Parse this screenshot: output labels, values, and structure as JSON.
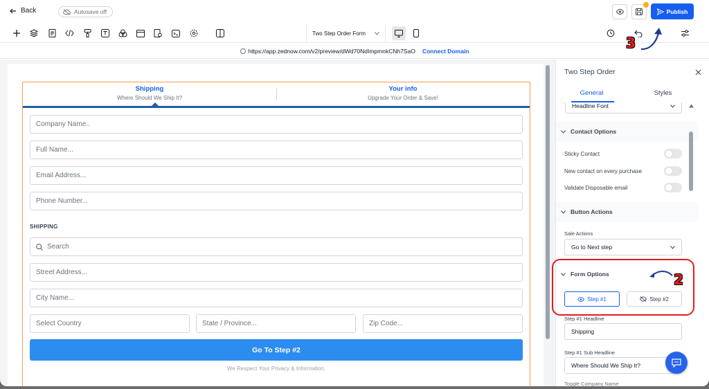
{
  "topbar": {
    "back_label": "Back",
    "autosave_label": "Autosave off",
    "publish_label": "Publish"
  },
  "toolbar": {
    "form_select_label": "Two Step Order Form"
  },
  "url": {
    "address": "https://app.zednow.com/v2/preview/dWd70NdImpmnkCNh7SaO",
    "connect_label": "Connect Domain"
  },
  "form": {
    "step1_title": "Shipping",
    "step1_sub": "Where Should We Ship It?",
    "step2_title": "Your info",
    "step2_sub": "Upgrade Your Order & Save!",
    "company_placeholder": "Company Name..",
    "fullname_placeholder": "Full Name...",
    "email_placeholder": "Email Address...",
    "phone_placeholder": "Phone Number...",
    "shipping_label": "SHIPPING",
    "search_placeholder": "Search",
    "street_placeholder": "Street Address...",
    "city_placeholder": "City Name...",
    "country_placeholder": "Select Country",
    "state_placeholder": "State / Province...",
    "zip_placeholder": "Zip Code...",
    "button_label": "Go To Step #2",
    "privacy_text": "We Respect Your Privacy & Information."
  },
  "panel": {
    "title": "Two Step Order",
    "tab_general": "General",
    "tab_styles": "Styles",
    "headline_font_value": "Headline Font",
    "contact_options_label": "Contact Options",
    "sticky_contact_label": "Sticky Contact",
    "new_contact_label": "New contact on every purchase",
    "validate_email_label": "Validate Disposable email",
    "button_actions_label": "Button Actions",
    "sale_actions_label": "Sale Actions",
    "sale_actions_value": "Go to Next step",
    "form_options_label": "Form Options",
    "step1_tab": "Step #1",
    "step2_tab": "Step #2",
    "step1_headline_label": "Step #1 Headline",
    "step1_headline_value": "Shipping",
    "step1_subheadline_label": "Step #1 Sub Headline",
    "step1_subheadline_value": "Where Should We Ship It?",
    "next_label_partial": "Toggle Company Name"
  },
  "annotations": {
    "marker_2": "2",
    "marker_3": "3",
    "marker_color": "#e11d1d"
  },
  "colors": {
    "primary": "#155eef",
    "button": "#2d8cf0",
    "step_bar": "#1f5fa8",
    "form_border": "#f59e52"
  }
}
